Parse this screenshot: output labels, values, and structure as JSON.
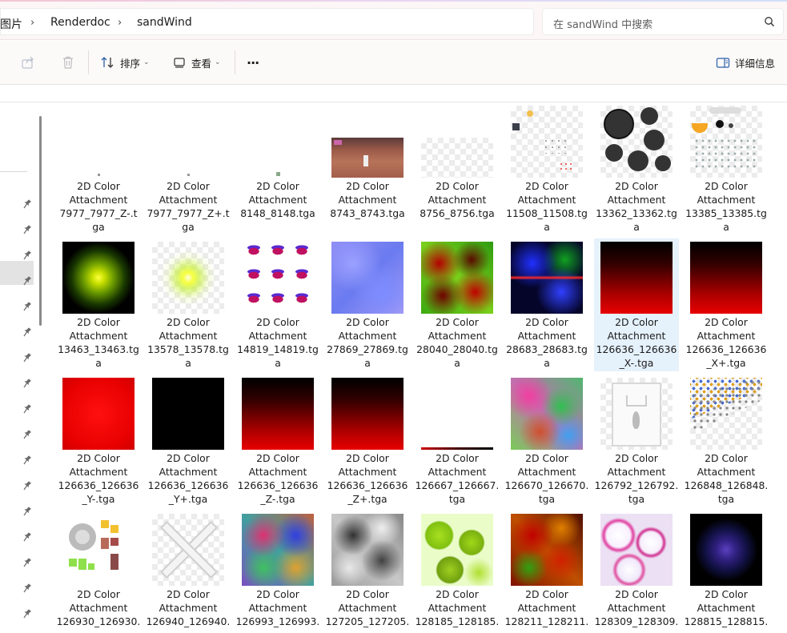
{
  "address": {
    "crumbs": [
      "图片",
      "Renderdoc",
      "sandWind"
    ],
    "search_placeholder": "在 sandWind 中搜索"
  },
  "commandbar": {
    "sort_label": "排序",
    "view_label": "查看",
    "more_label": "···",
    "details_label": "详细信息"
  },
  "files": [
    {
      "line1": "2D Color",
      "line2": "Attachment",
      "line3": "7977_7977_Z-.t",
      "line4": "ga",
      "thumb": "dot-tiny"
    },
    {
      "line1": "2D Color",
      "line2": "Attachment",
      "line3": "7977_7977_Z+.t",
      "line4": "ga",
      "thumb": "dot-tiny"
    },
    {
      "line1": "2D Color",
      "line2": "Attachment",
      "line3": "8148_8148.tga",
      "line4": "",
      "thumb": "dot-small"
    },
    {
      "line1": "2D Color",
      "line2": "Attachment",
      "line3": "8743_8743.tga",
      "line4": "",
      "thumb": "game-screenshot"
    },
    {
      "line1": "2D Color",
      "line2": "Attachment",
      "line3": "8756_8756.tga",
      "line4": "",
      "thumb": "transparent-wide"
    },
    {
      "line1": "2D Color",
      "line2": "Attachment",
      "line3": "11508_11508.tg",
      "line4": "a",
      "thumb": "icon-atlas-small"
    },
    {
      "line1": "2D Color",
      "line2": "Attachment",
      "line3": "13362_13362.tg",
      "line4": "a",
      "thumb": "black-circles"
    },
    {
      "line1": "2D Color",
      "line2": "Attachment",
      "line3": "13385_13385.tg",
      "line4": "a",
      "thumb": "ui-atlas"
    },
    {
      "line1": "2D Color",
      "line2": "Attachment",
      "line3": "13463_13463.tg",
      "line4": "a",
      "thumb": "yellow-radial-black"
    },
    {
      "line1": "2D Color",
      "line2": "Attachment",
      "line3": "13578_13578.tg",
      "line4": "a",
      "thumb": "yellow-radial-transparent"
    },
    {
      "line1": "2D Color",
      "line2": "Attachment",
      "line3": "14819_14819.tg",
      "line4": "a",
      "thumb": "purple-sprites"
    },
    {
      "line1": "2D Color",
      "line2": "Attachment",
      "line3": "27869_27869.tg",
      "line4": "a",
      "thumb": "normal-map"
    },
    {
      "line1": "2D Color",
      "line2": "Attachment",
      "line3": "28040_28040.tg",
      "line4": "a",
      "thumb": "red-green-noise"
    },
    {
      "line1": "2D Color",
      "line2": "Attachment",
      "line3": "28683_28683.tg",
      "line4": "a",
      "thumb": "blue-red-noise"
    },
    {
      "line1": "2D Color",
      "line2": "Attachment",
      "line3": "126636_126636",
      "line4": "_X-.tga",
      "thumb": "black-red-gradient",
      "selected": true
    },
    {
      "line1": "2D Color",
      "line2": "Attachment",
      "line3": "126636_126636",
      "line4": "_X+.tga",
      "thumb": "black-red-gradient"
    },
    {
      "line1": "2D Color",
      "line2": "Attachment",
      "line3": "126636_126636",
      "line4": "_Y-.tga",
      "thumb": "red-solid"
    },
    {
      "line1": "2D Color",
      "line2": "Attachment",
      "line3": "126636_126636",
      "line4": "_Y+.tga",
      "thumb": "black-solid"
    },
    {
      "line1": "2D Color",
      "line2": "Attachment",
      "line3": "126636_126636",
      "line4": "_Z-.tga",
      "thumb": "black-red-gradient"
    },
    {
      "line1": "2D Color",
      "line2": "Attachment",
      "line3": "126636_126636",
      "line4": "_Z+.tga",
      "thumb": "black-red-gradient"
    },
    {
      "line1": "2D Color",
      "line2": "Attachment",
      "line3": "126667_126667.",
      "line4": "tga",
      "thumb": "thin-strip"
    },
    {
      "line1": "2D Color",
      "line2": "Attachment",
      "line3": "126670_126670.",
      "line4": "tga",
      "thumb": "rainbow-noise"
    },
    {
      "line1": "2D Color",
      "line2": "Attachment",
      "line3": "126792_126792.",
      "line4": "tga",
      "thumb": "white-banner"
    },
    {
      "line1": "2D Color",
      "line2": "Attachment",
      "line3": "126848_126848.",
      "line4": "tga",
      "thumb": "icon-atlas-dense"
    },
    {
      "line1": "2D Color",
      "line2": "Attachment",
      "line3": "126930_126930.",
      "line4": "",
      "thumb": "color-swatches"
    },
    {
      "line1": "2D Color",
      "line2": "Attachment",
      "line3": "126940_126940.",
      "line4": "",
      "thumb": "white-swords"
    },
    {
      "line1": "2D Color",
      "line2": "Attachment",
      "line3": "126993_126993.",
      "line4": "",
      "thumb": "rainbow-noise-2"
    },
    {
      "line1": "2D Color",
      "line2": "Attachment",
      "line3": "127205_127205.",
      "line4": "",
      "thumb": "grey-clouds"
    },
    {
      "line1": "2D Color",
      "line2": "Attachment",
      "line3": "128185_128185.",
      "line4": "",
      "thumb": "green-cells"
    },
    {
      "line1": "2D Color",
      "line2": "Attachment",
      "line3": "128211_128211.",
      "line4": "",
      "thumb": "red-orange-noise"
    },
    {
      "line1": "2D Color",
      "line2": "Attachment",
      "line3": "128309_128309.",
      "line4": "",
      "thumb": "pink-cells"
    },
    {
      "line1": "2D Color",
      "line2": "Attachment",
      "line3": "128815_128815.",
      "line4": "",
      "thumb": "blue-dark-glow"
    }
  ]
}
